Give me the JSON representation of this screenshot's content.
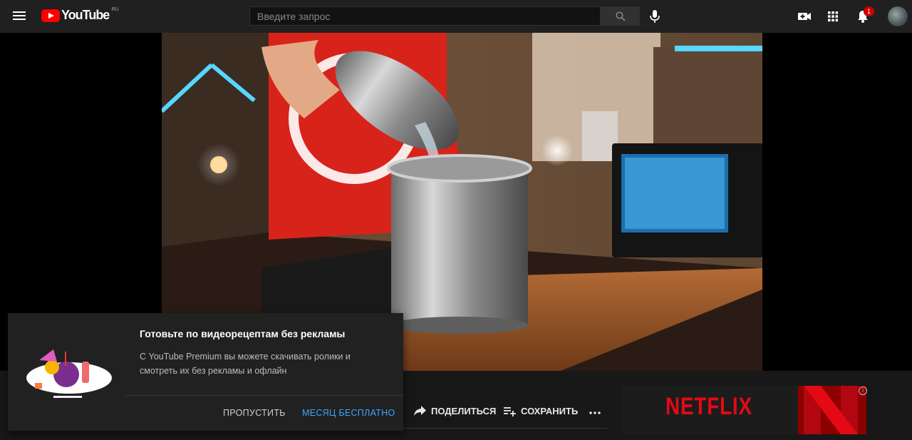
{
  "header": {
    "logo_text": "YouTube",
    "region": "RU",
    "search_placeholder": "Введите запрос",
    "notifications_count": "1"
  },
  "actions": {
    "share_label": "ПОДЕЛИТЬСЯ",
    "save_label": "СОХРАНИТЬ"
  },
  "ad": {
    "brand_text": "NETFLIX",
    "info_glyph": "i",
    "brand_color": "#e50914"
  },
  "premium_popup": {
    "title": "Готовьте по видеорецептам без рекламы",
    "description": "С YouTube Premium вы можете скачивать ролики и смотреть их без рекламы и офлайн",
    "skip_label": "ПРОПУСТИТЬ",
    "trial_label": "МЕСЯЦ БЕСПЛАТНО",
    "accent_color": "#3ea6ff"
  },
  "icons": [
    "menu-icon",
    "youtube-logo-icon",
    "search-icon",
    "mic-icon",
    "create-video-icon",
    "apps-icon",
    "bell-icon",
    "share-icon",
    "playlist-add-icon",
    "more-icon"
  ]
}
